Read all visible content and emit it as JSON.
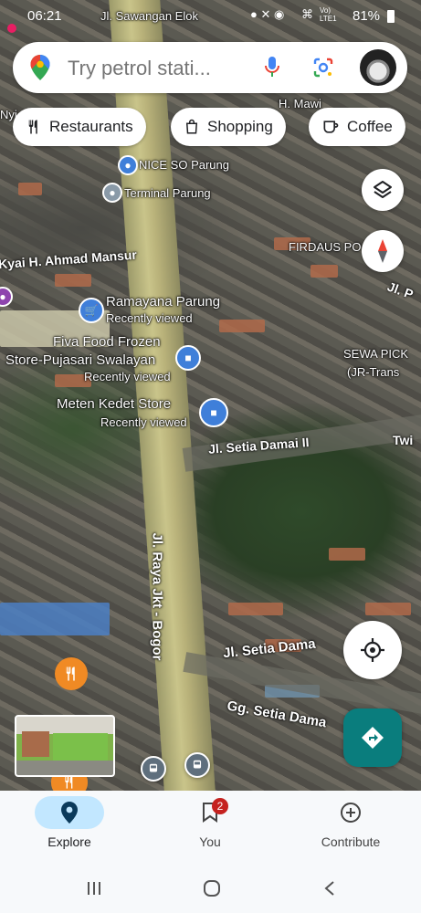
{
  "status_bar": {
    "time": "06:21",
    "battery": "81%",
    "network": "Vo) LTE1"
  },
  "search": {
    "placeholder": "Try petrol stati..."
  },
  "chips": [
    {
      "label": "Restaurants",
      "icon": "fork-knife-icon"
    },
    {
      "label": "Shopping",
      "icon": "shopping-bag-icon"
    },
    {
      "label": "Coffee",
      "icon": "coffee-cup-icon"
    }
  ],
  "map_labels": {
    "street_top": "Jl. Sawangan Elok",
    "mawi": "H. Mawi",
    "nice_so": "NICE SO Parung",
    "terminal": "Terminal Parung",
    "ahmad_mansur": "Kyai H. Ahmad Mansur",
    "firdaus": "FIRDAUS PO",
    "ramayana": "Ramayana Parung",
    "ramayana_sub": "Recently viewed",
    "fiva_1": "Fiva Food Frozen",
    "fiva_2": "Store-Pujasari Swalayan",
    "fiva_sub": "Recently viewed",
    "sewa_1": "SEWA PICK",
    "sewa_2": "(JR-Trans",
    "meten": "Meten Kedet Store",
    "meten_sub": "Recently viewed",
    "setia_damai_ii": "Jl. Setia Damai II",
    "twi": "Twi",
    "raya": "Jl. Raya Jkt - Bogor",
    "setia_damai": "Jl. Setia Dama",
    "gg_setia": "Gg. Setia Dama",
    "jl_p": "Jl. P",
    "nyi": "Nyi"
  },
  "nav": {
    "explore": "Explore",
    "you": "You",
    "you_badge": "2",
    "contribute": "Contribute"
  },
  "colors": {
    "accent": "#1a73e8",
    "directions": "#0a7d7d",
    "explore_pill": "#c2e7ff",
    "badge": "#c5221f"
  }
}
